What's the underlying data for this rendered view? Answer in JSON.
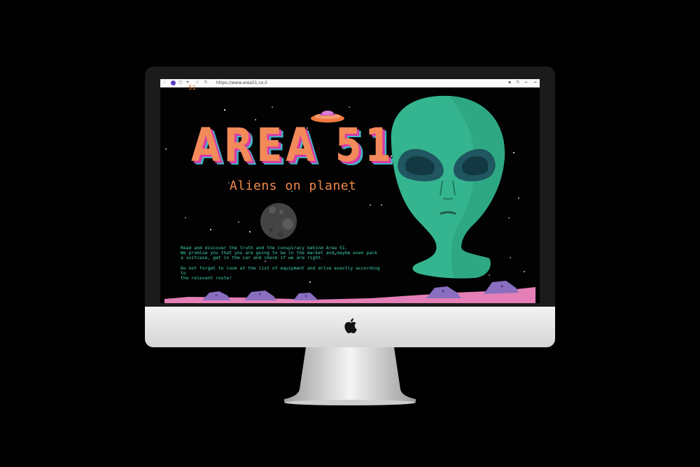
{
  "browser": {
    "url": "https://www.area51.co.il",
    "profile_initial": "A"
  },
  "page": {
    "page_number": "51",
    "title": "AREA 51",
    "subtitle": "Aliens on planet",
    "paragraph_1_line_1": "Read and discover the truth and the conspiracy behind Area 51.",
    "paragraph_1_line_2": "We promise you that you are going to be in the market and maybe even pack",
    "paragraph_1_line_3": "a suitcase, get in the car and check if we are right.",
    "paragraph_2_line_1": "Do not forget to look at the list of equipment and drive exactly according to",
    "paragraph_2_line_2": "the relevant route!"
  },
  "colors": {
    "title_orange": "#f38a5a",
    "title_shadow_pink": "#d93aa6",
    "title_shadow_teal": "#3eb7c9",
    "text_teal": "#3fd4b0",
    "alien_green": "#35b58f",
    "ground_pink": "#e47fb7",
    "rock_purple": "#8a6fc0"
  },
  "icons": [
    "back-icon",
    "tab-icon",
    "extension-icon",
    "star-icon",
    "reload-icon",
    "lock-icon",
    "forward-icon",
    "apple-logo-icon",
    "ufo-icon",
    "moon-icon",
    "alien-head-icon"
  ]
}
